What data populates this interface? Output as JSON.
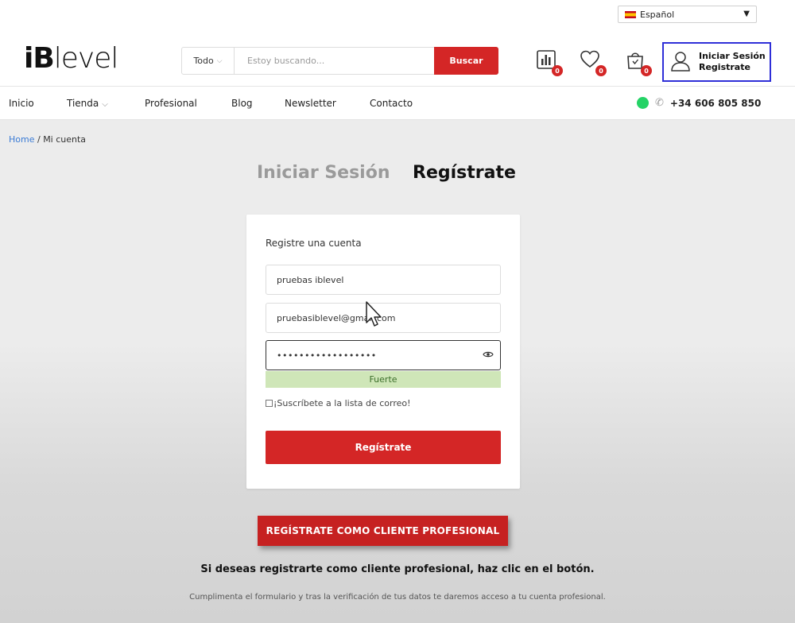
{
  "header": {
    "language": "Español",
    "logo": {
      "part1": "iB",
      "part2": "level"
    },
    "search": {
      "category": "Todo",
      "placeholder": "Estoy buscando...",
      "button": "Buscar"
    },
    "icons": [
      {
        "name": "compare-icon",
        "count": "0"
      },
      {
        "name": "wishlist-heart-icon",
        "count": "0"
      },
      {
        "name": "cart-bag-icon",
        "count": "0"
      }
    ],
    "account": {
      "login": "Iniciar Sesión",
      "register": "Registrate"
    }
  },
  "nav": {
    "items": [
      "Inicio",
      "Tienda",
      "Profesional",
      "Blog",
      "Newsletter",
      "Contacto"
    ],
    "phone": "+34 606 805 850"
  },
  "breadcrumb": {
    "home": "Home",
    "separator": " / ",
    "current": "Mi cuenta"
  },
  "tabs": {
    "login": "Iniciar Sesión",
    "register": "Regístrate"
  },
  "form": {
    "title": "Registre una cuenta",
    "username": "pruebas iblevel",
    "email": "pruebasiblevel@gmail.com",
    "password": "••••••••••••••••••",
    "strength": "Fuerte",
    "newsletter": "¡Suscríbete a la lista de correo!",
    "submit": "Regístrate"
  },
  "pro": {
    "button": "REGÍSTRATE COMO CLIENTE PROFESIONAL",
    "text": "Si deseas registrarte como cliente profesional, haz clic en el botón.",
    "subtext": "Cumplimenta el formulario y tras la verificación de tus datos te daremos acceso a tu cuenta profesional."
  },
  "colors": {
    "accent": "#d42626",
    "highlight": "#2f2fd8",
    "strength": "#cfe6b8",
    "link": "#3a7bd5"
  }
}
